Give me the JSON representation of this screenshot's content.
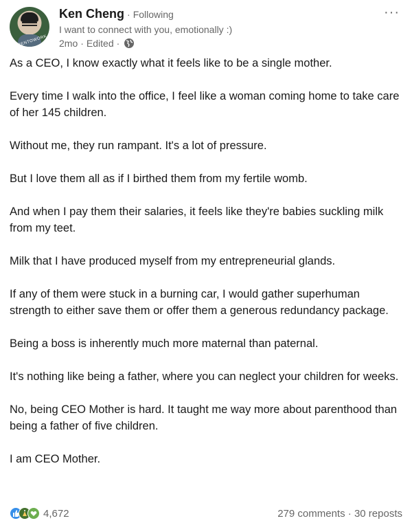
{
  "author": {
    "name": "Ken Cheng",
    "following": "Following",
    "headline": "I want to connect with you, emotionally :)",
    "time": "2mo",
    "edited": "Edited",
    "avatar_badge": "#OPENTOWORK"
  },
  "post": {
    "paragraphs": [
      "As a CEO, I know exactly what it feels like to be a single mother.",
      "Every time I walk into the office, I feel like a woman coming home to take care of her 145 children.",
      "Without me, they run rampant. It's a lot of pressure.",
      "But I love them all as if I birthed them from my fertile womb.",
      "And when I pay them their salaries, it feels like they're babies suckling milk from my teet.",
      "Milk that I have produced myself from my entrepreneurial glands.",
      "If any of them were stuck in a burning car, I would gather superhuman strength to either save them or offer them a generous redundancy package.",
      "Being a boss is inherently much more maternal than paternal.",
      "It's nothing like being a father, where you can neglect your children for weeks.",
      "No, being CEO Mother is hard. It taught me way more about parenthood than being a father of five children.",
      "I am CEO Mother."
    ]
  },
  "footer": {
    "reaction_count": "4,672",
    "comments": "279 comments",
    "reposts": "30 reposts",
    "separator": "·"
  },
  "icons": {
    "reactions": [
      "like-icon",
      "celebrate-icon",
      "support-icon"
    ],
    "globe": "globe-icon",
    "more": "ellipsis-icon"
  },
  "colors": {
    "like": "#378fe9",
    "celebrate": "#44712e",
    "support": "#6dae4f",
    "meta_text": "#666666"
  }
}
